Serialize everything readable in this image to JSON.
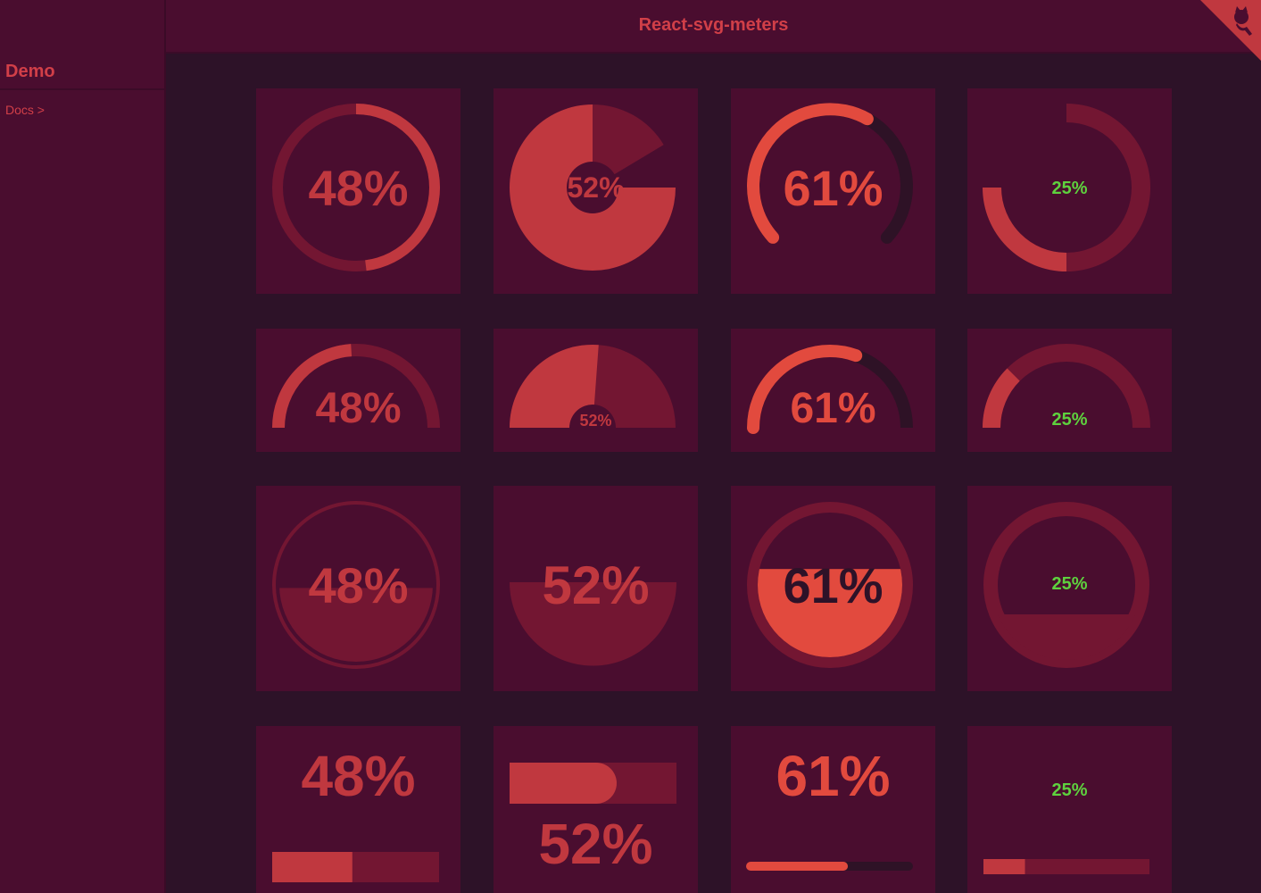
{
  "sidebar": {
    "title": "Demo",
    "docs_link": "Docs >"
  },
  "header": {
    "title": "React-svg-meters",
    "github_icon": "github-octocat-icon"
  },
  "colors": {
    "page_bg": "#2d1228",
    "card_bg": "#4a0d2f",
    "track": "#731632",
    "red": "#c0383f",
    "coral": "#e24a3e",
    "dark_track": "#2e1226",
    "green": "#5ed23e"
  },
  "meters": {
    "red_48": {
      "value": 48,
      "label": "48%"
    },
    "maroon_52": {
      "value": 52,
      "label": "52%"
    },
    "coral_61": {
      "value": 61,
      "label": "61%"
    },
    "green_25": {
      "value": 25,
      "label": "25%"
    }
  },
  "rows": [
    "circle",
    "half-circle",
    "fill-level",
    "bar"
  ]
}
